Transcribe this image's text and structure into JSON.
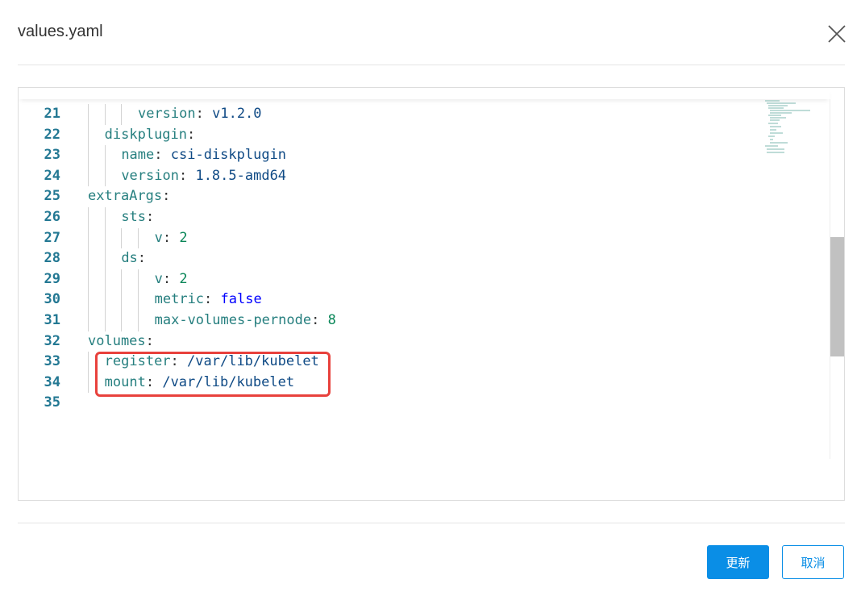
{
  "dialog": {
    "title": "values.yaml",
    "ok_label": "更新",
    "cancel_label": "取消"
  },
  "editor": {
    "lines": [
      {
        "n": "21",
        "indent": 6,
        "key": "version",
        "value": "v1.2.0",
        "vtype": "s"
      },
      {
        "n": "22",
        "indent": 2,
        "key": "diskplugin",
        "value": "",
        "vtype": ""
      },
      {
        "n": "23",
        "indent": 4,
        "key": "name",
        "value": "csi-diskplugin",
        "vtype": "s"
      },
      {
        "n": "24",
        "indent": 4,
        "key": "version",
        "value": "1.8.5-amd64",
        "vtype": "s"
      },
      {
        "n": "25",
        "indent": 0,
        "key": "extraArgs",
        "value": "",
        "vtype": ""
      },
      {
        "n": "26",
        "indent": 4,
        "key": "sts",
        "value": "",
        "vtype": ""
      },
      {
        "n": "27",
        "indent": 8,
        "key": "v",
        "value": "2",
        "vtype": "n"
      },
      {
        "n": "28",
        "indent": 4,
        "key": "ds",
        "value": "",
        "vtype": ""
      },
      {
        "n": "29",
        "indent": 8,
        "key": "v",
        "value": "2",
        "vtype": "n"
      },
      {
        "n": "30",
        "indent": 8,
        "key": "metric",
        "value": "false",
        "vtype": "b"
      },
      {
        "n": "31",
        "indent": 8,
        "key": "max-volumes-pernode",
        "value": "8",
        "vtype": "n"
      },
      {
        "n": "32",
        "indent": 0,
        "key": "volumes",
        "value": "",
        "vtype": ""
      },
      {
        "n": "33",
        "indent": 2,
        "key": "register",
        "value": "/var/lib/kubelet",
        "vtype": "s"
      },
      {
        "n": "34",
        "indent": 2,
        "key": "mount",
        "value": "/var/lib/kubelet",
        "vtype": "s"
      },
      {
        "n": "35",
        "indent": 0,
        "key": "",
        "value": "",
        "vtype": ""
      }
    ]
  }
}
